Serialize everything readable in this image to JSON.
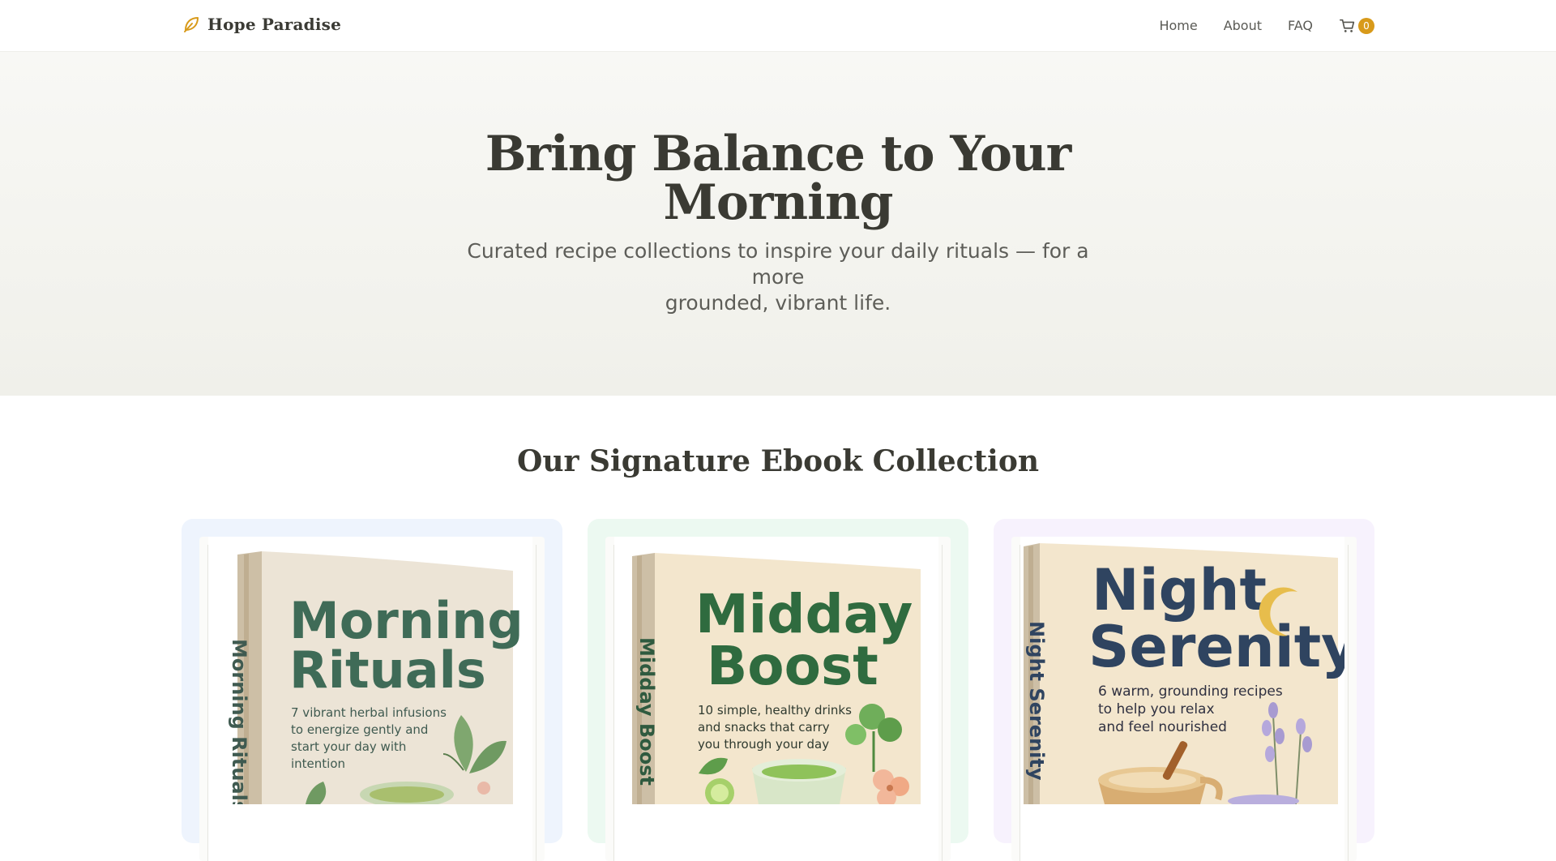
{
  "nav": {
    "brand": "Hope Paradise",
    "links": [
      "Home",
      "About",
      "FAQ"
    ],
    "cart_count": "0"
  },
  "hero": {
    "title_line1": "Bring Balance to Your",
    "title_line2": "Morning",
    "subtitle_line1": "Curated recipe collections to inspire your daily rituals — for a more",
    "subtitle_line2": "grounded, vibrant life."
  },
  "collection": {
    "title": "Our Signature Ebook Collection",
    "books": [
      {
        "title_line1": "Morning",
        "title_line2": "Rituals",
        "spine": "Morning Rituals",
        "desc": [
          "7 vibrant herbal infusions",
          "to energize gently and",
          "start your day with",
          "intention"
        ],
        "accent": "#eef4fd"
      },
      {
        "title_line1": "Midday",
        "title_line2": "Boost",
        "spine": "Midday Boost",
        "desc": [
          "10 simple, healthy drinks",
          "and snacks that carry",
          "you through your day"
        ],
        "accent": "#ecf9f1"
      },
      {
        "title_line1": "Night",
        "title_line2": "Serenity",
        "spine": "Night Serenity",
        "desc": [
          "6 warm, grounding recipes",
          "to help you relax",
          "and feel nourished"
        ],
        "accent": "#f7f2fd"
      }
    ]
  },
  "colors": {
    "accent": "#d89a1a",
    "heading": "#3a3a33",
    "book_green": "#3f6b57",
    "book_navy": "#2f4460"
  }
}
